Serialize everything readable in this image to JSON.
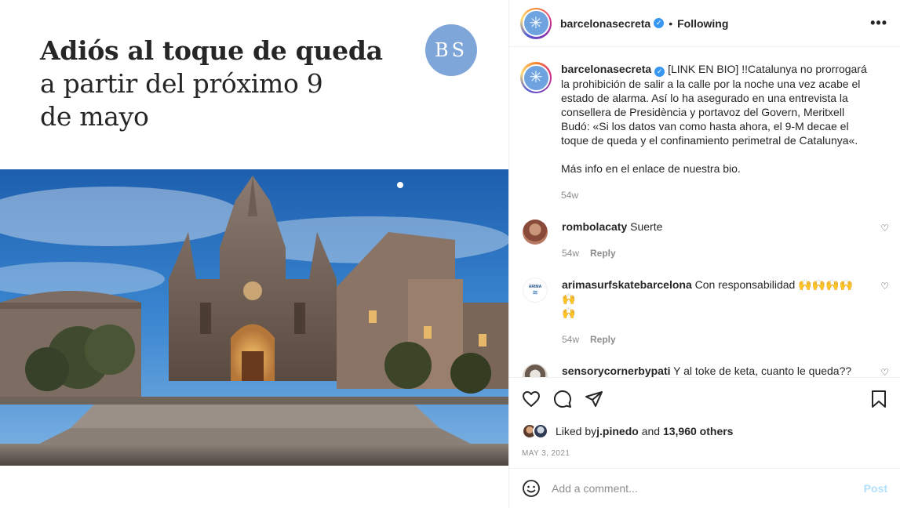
{
  "media": {
    "headline_line1": "Adiós al toque de queda",
    "headline_line2": "a partir del próximo 9",
    "headline_line3": "de mayo",
    "logo_text": "BS"
  },
  "header": {
    "username": "barcelonasecreta",
    "separator": "•",
    "follow_status": "Following",
    "more": "•••"
  },
  "caption": {
    "username": "barcelonasecreta",
    "text": " [LINK EN BIO] !!Catalunya no prorrogará la prohibición de salir a la calle por la noche una vez acabe el estado de alarma. Así lo ha asegurado en una entrevista la consellera de Presidència y portavoz del Govern, Meritxell Budó: «Si los datos van como hasta ahora, el 9-M decae el toque de queda y el confinamiento perimetral de Catalunya«.",
    "more_info": "Más info en el enlace de nuestra bio.",
    "time": "54w"
  },
  "comments": [
    {
      "username": "rombolacaty",
      "text": " Suerte",
      "time": "54w",
      "reply": "Reply"
    },
    {
      "username": "arimasurfskatebarcelona",
      "text": " Con responsabilidad 🙌🙌🙌🙌🙌",
      "text2": "🙌",
      "time": "54w",
      "reply": "Reply",
      "avatar_text": "ARIMA"
    },
    {
      "username": "sensorycornerbypati",
      "text": " Y al toke de keta, cuanto le queda??"
    }
  ],
  "likes": {
    "prefix": "Liked by ",
    "user": "j.pinedo",
    "middle": " and ",
    "others": "13,960 others"
  },
  "date": "MAY 3, 2021",
  "add_comment": {
    "placeholder": "Add a comment...",
    "post": "Post"
  },
  "colors": {
    "accent": "#0095f6",
    "post_disabled": "#b2dffc",
    "logo_bg": "#7fa6d8"
  }
}
